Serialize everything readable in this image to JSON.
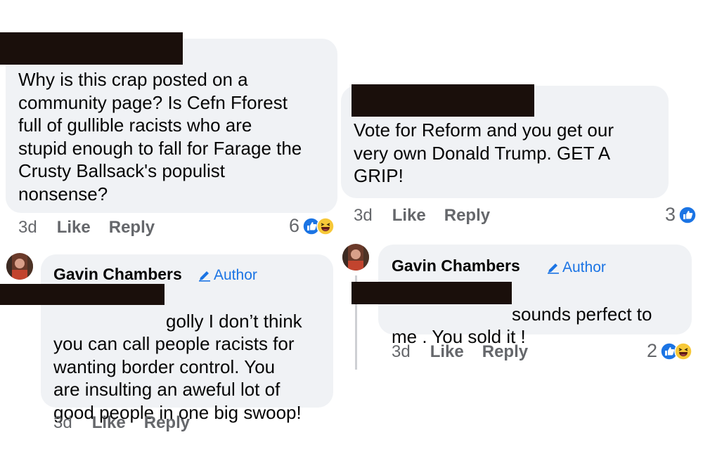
{
  "comments": [
    {
      "text": "Why is this crap posted on a\ncommunity page? Is Cefn Fforest\nfull of gullible racists who are\nstupid enough to fall for Farage the\nCrusty Ballsack's populist\nnonsense?",
      "time": "3d",
      "like": "Like",
      "reply": "Reply",
      "reactions": "6"
    },
    {
      "text": "Vote for Reform and you get our\nvery own Donald Trump. GET A\nGRIP!",
      "time": "3d",
      "like": "Like",
      "reply": "Reply",
      "reactions": "3"
    }
  ],
  "replies": [
    {
      "name": "Gavin Chambers",
      "badge": "Author",
      "text": "golly I don’t think\nyou can call people racists for\nwanting border control. You\nare insulting an aweful lot of\ngood people in one big swoop!",
      "time": "3d",
      "like": "Like",
      "reply": "Reply"
    },
    {
      "name": "Gavin Chambers",
      "badge": "Author",
      "text": "sounds perfect to\nme . You sold it !",
      "time": "3d",
      "like": "Like",
      "reply": "Reply",
      "reactions": "2"
    }
  ],
  "colors": {
    "bubble": "#f0f2f5",
    "meta": "#65676b",
    "accent": "#1b74e4",
    "redaction": "#1a0f0b"
  }
}
